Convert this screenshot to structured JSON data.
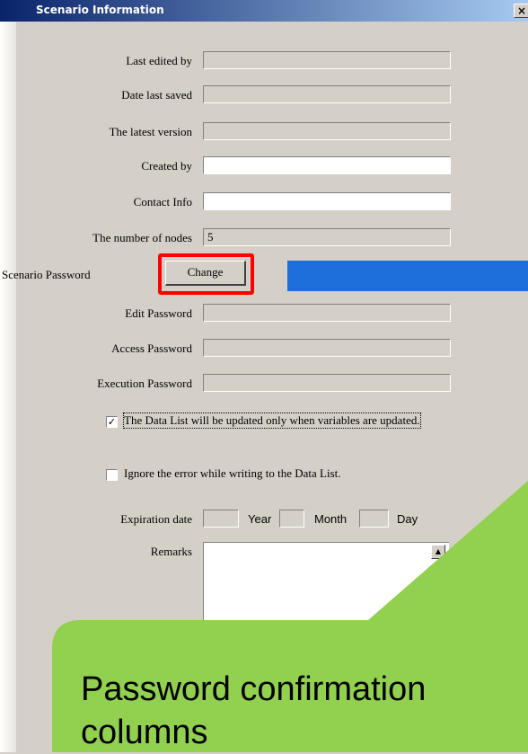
{
  "window": {
    "title": "Scenario Information",
    "close_label": "×"
  },
  "fields": [
    {
      "label": "Last edited by",
      "value": ""
    },
    {
      "label": "Date last saved",
      "value": ""
    },
    {
      "label": "The latest version",
      "value": ""
    },
    {
      "label": "Created by",
      "value": ""
    },
    {
      "label": "Contact Info",
      "value": ""
    },
    {
      "label": "The number of nodes",
      "value": "5"
    }
  ],
  "password": {
    "label": "Scenario Password",
    "change_label": "Change",
    "edit_label": "Edit Password",
    "access_label": "Access Password",
    "execution_label": "Execution Password"
  },
  "options": {
    "data_list_update_label": "The Data List will be updated only when variables are updated.",
    "data_list_update_checked": true,
    "ignore_error_label": "Ignore the error while writing to the Data List.",
    "ignore_error_checked": false
  },
  "expiration": {
    "label": "Expiration date",
    "year_label": "Year",
    "month_label": "Month",
    "day_label": "Day",
    "year_value": "",
    "month_value": "",
    "day_value": ""
  },
  "remarks": {
    "label": "Remarks",
    "value": ""
  },
  "callout": {
    "text": "Password confirmation columns",
    "line1": "Password confirmation",
    "line2": "columns"
  },
  "colors": {
    "highlight_box": "#ff0000",
    "arrow_bar": "#1e6fd9",
    "callout_fill": "#92d050"
  }
}
